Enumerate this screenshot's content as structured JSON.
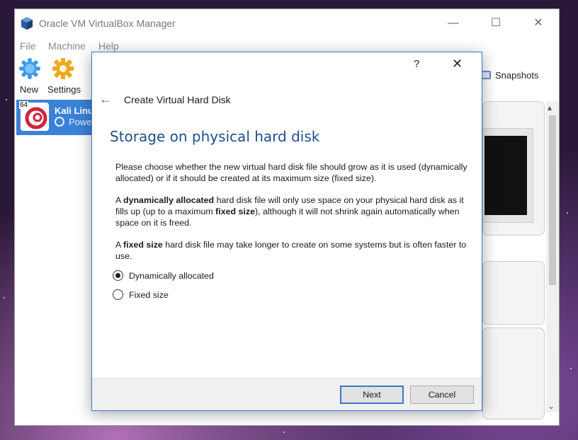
{
  "window": {
    "title": "Oracle VM VirtualBox Manager",
    "minimize": "—",
    "maximize": "☐",
    "close": "✕"
  },
  "menu": {
    "items": [
      "File",
      "Machine",
      "Help"
    ]
  },
  "toolbar": {
    "new_label": "New",
    "settings_label": "Settings",
    "snapshots_label": "Snapshots"
  },
  "vm_list": {
    "items": [
      {
        "name": "Kali Linux",
        "state": "Powered Off",
        "arch_badge": "64"
      }
    ]
  },
  "dialog": {
    "help": "?",
    "close": "✕",
    "back": "←",
    "title": "Create Virtual Hard Disk",
    "heading": "Storage on physical hard disk",
    "para1": "Please choose whether the new virtual hard disk file should grow as it is used (dynamically allocated) or if it should be created at its maximum size (fixed size).",
    "para2": {
      "t1": "A ",
      "b1": "dynamically allocated",
      "t2": " hard disk file will only use space on your physical hard disk as it fills up (up to a maximum ",
      "b2": "fixed size",
      "t3": "), although it will not shrink again automatically when space on it is freed."
    },
    "para3": {
      "t1": "A ",
      "b1": "fixed size",
      "t2": " hard disk file may take longer to create on some systems but is often faster to use."
    },
    "options": [
      {
        "label": "Dynamically allocated",
        "selected": true
      },
      {
        "label": "Fixed size",
        "selected": false
      }
    ],
    "next_label": "Next",
    "cancel_label": "Cancel"
  },
  "colors": {
    "accent": "#3c78c8",
    "heading": "#1f4e8c",
    "selection": "#3a82d6"
  }
}
